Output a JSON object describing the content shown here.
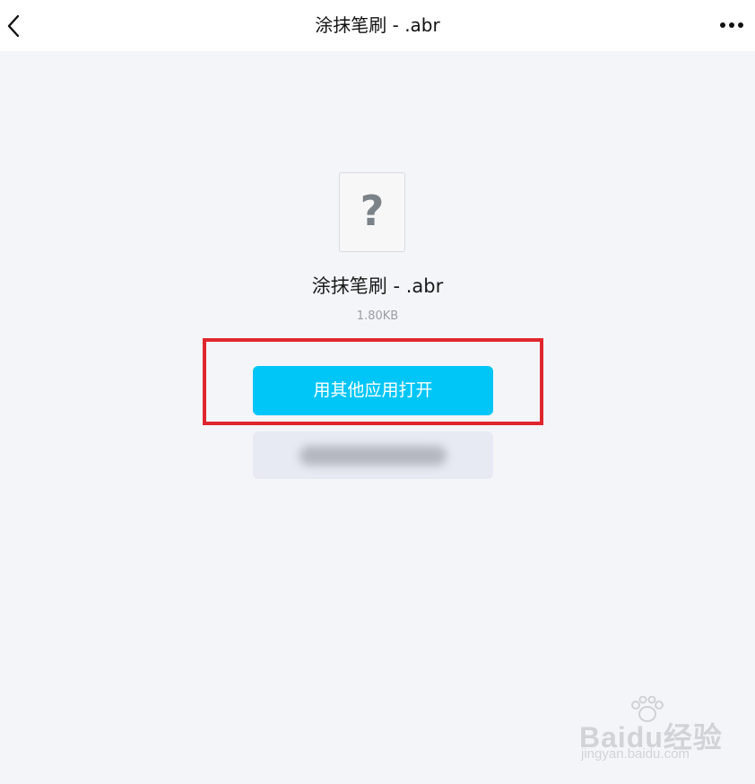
{
  "header": {
    "title": "涂抹笔刷 - .abr",
    "back_icon": "chevron-left-icon",
    "more_icon": "ellipsis-icon"
  },
  "file": {
    "icon": "unknown-file-icon",
    "icon_glyph": "?",
    "name": "涂抹笔刷 - .abr",
    "size": "1.80KB"
  },
  "actions": {
    "open_with_label": "用其他应用打开",
    "secondary_label": ""
  },
  "colors": {
    "primary_button": "#00c6f7",
    "highlight_border": "#e0262d",
    "background": "#f4f5f9"
  },
  "watermark": {
    "logo_text": "Baidu经验",
    "url": "jingyan.baidu.com"
  }
}
